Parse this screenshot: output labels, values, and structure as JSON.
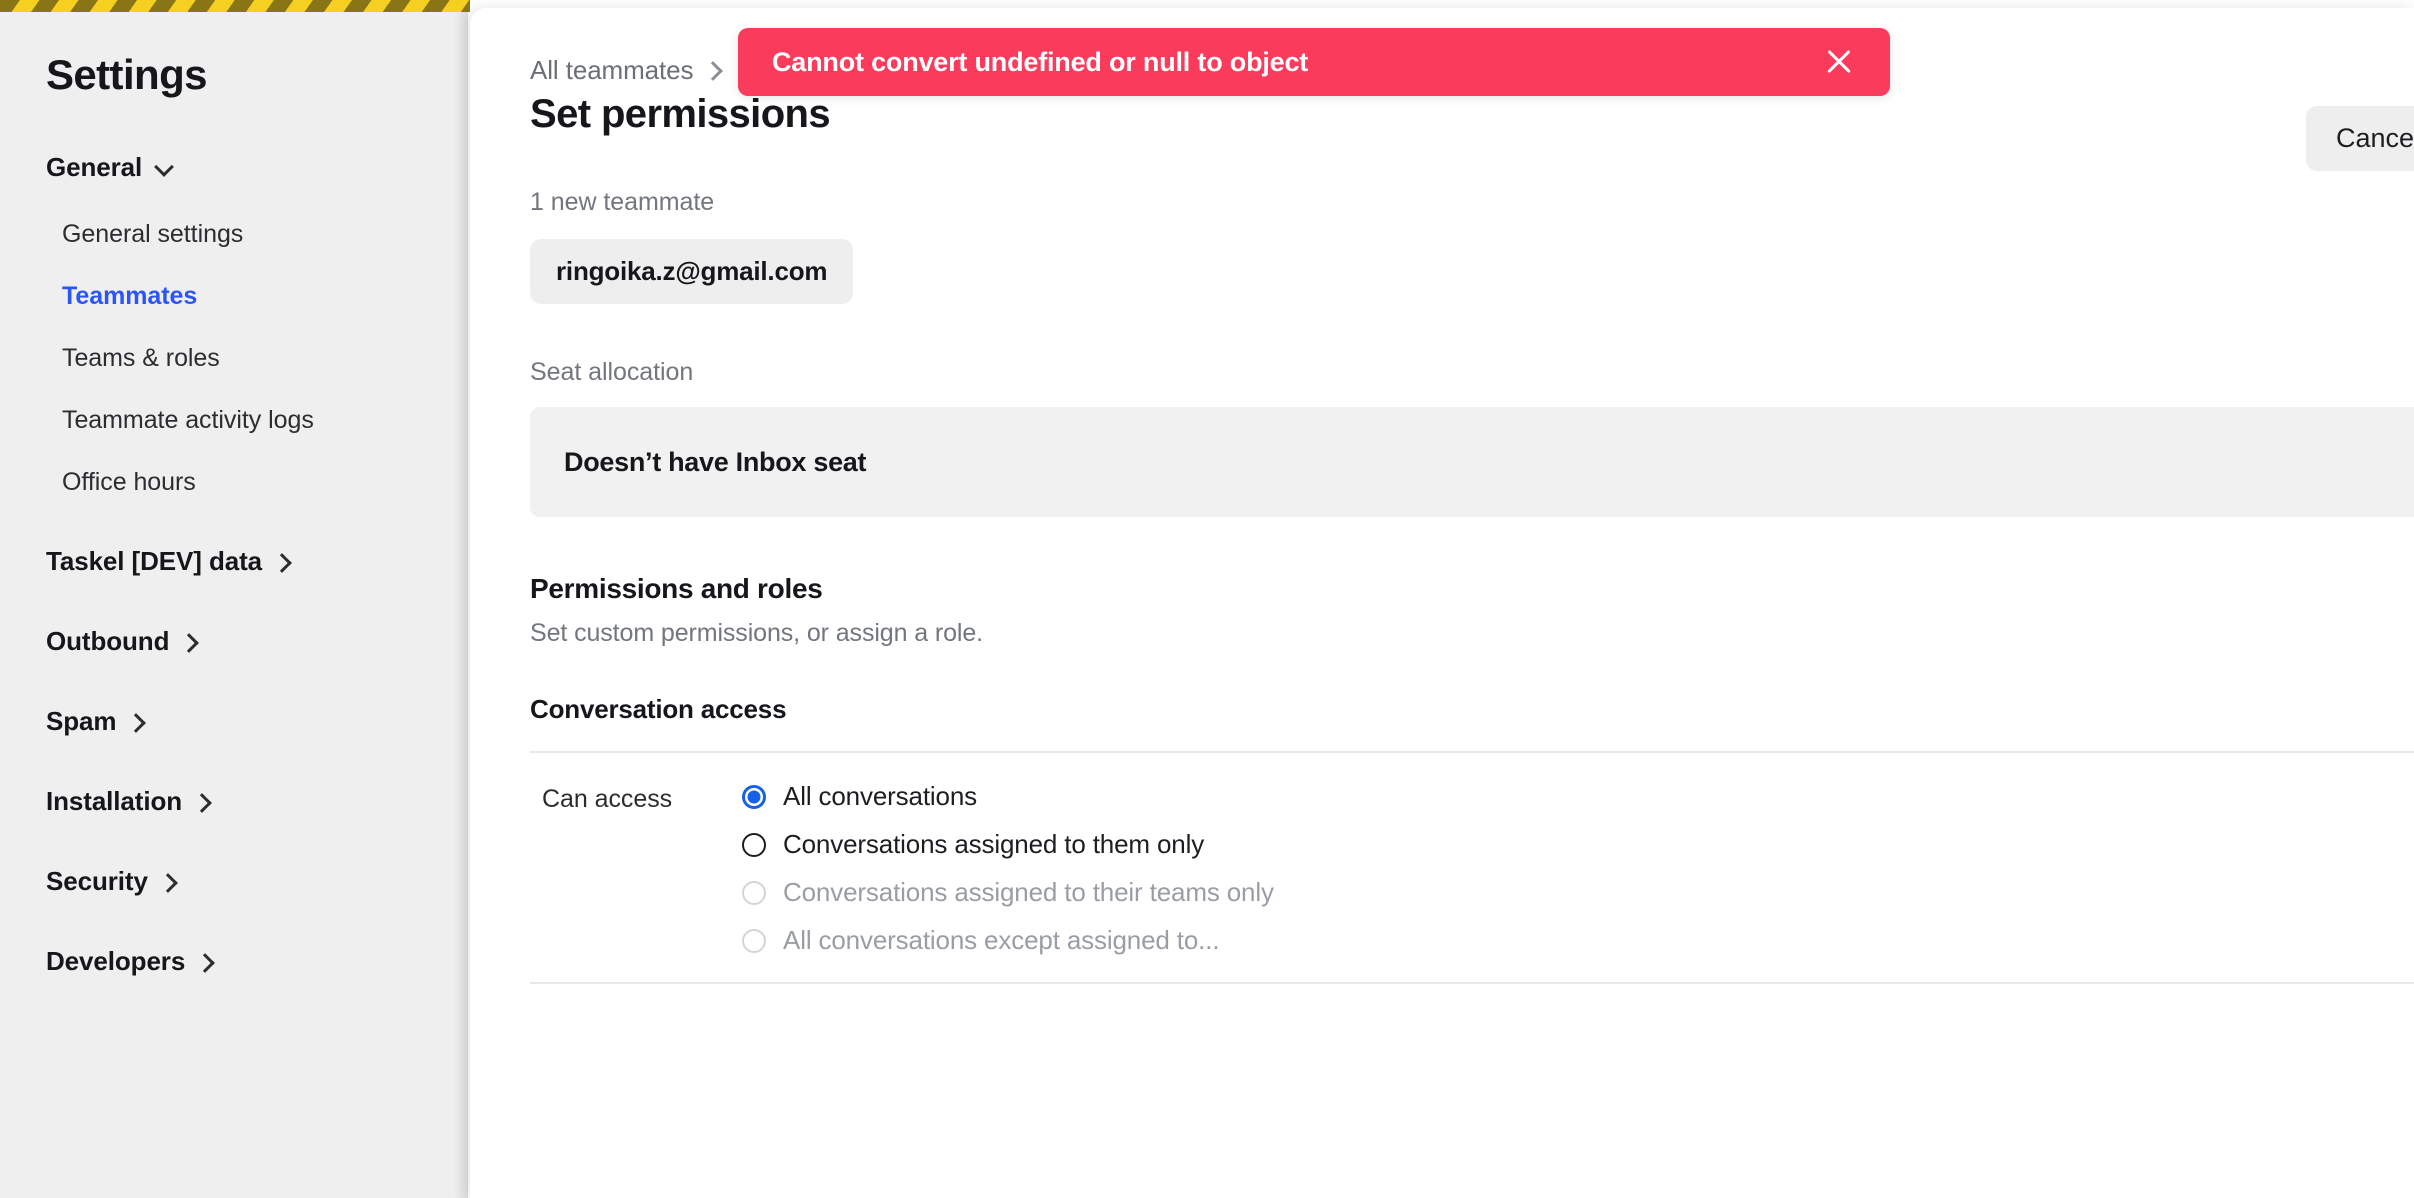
{
  "sidebar": {
    "title": "Settings",
    "groups": [
      {
        "label": "General",
        "expanded": true,
        "icon": "chevron-down-icon",
        "items": [
          {
            "label": "General settings",
            "active": false
          },
          {
            "label": "Teammates",
            "active": true
          },
          {
            "label": "Teams & roles",
            "active": false
          },
          {
            "label": "Teammate activity logs",
            "active": false
          },
          {
            "label": "Office hours",
            "active": false
          }
        ]
      },
      {
        "label": "Taskel [DEV] data",
        "expanded": false,
        "icon": "chevron-right-icon",
        "items": []
      },
      {
        "label": "Outbound",
        "expanded": false,
        "icon": "chevron-right-icon",
        "items": []
      },
      {
        "label": "Spam",
        "expanded": false,
        "icon": "chevron-right-icon",
        "items": []
      },
      {
        "label": "Installation",
        "expanded": false,
        "icon": "chevron-right-icon",
        "items": []
      },
      {
        "label": "Security",
        "expanded": false,
        "icon": "chevron-right-icon",
        "items": []
      },
      {
        "label": "Developers",
        "expanded": false,
        "icon": "chevron-right-icon",
        "items": []
      }
    ]
  },
  "toast": {
    "message": "Cannot convert undefined or null to object",
    "close_icon": "close-icon",
    "background": "#fa3b5b",
    "text_color": "#ffffff"
  },
  "header": {
    "breadcrumb_parent": "All teammates",
    "breadcrumb_separator_icon": "chevron-right-icon",
    "page_title": "Set permissions",
    "cancel_label": "Cancel"
  },
  "teammates": {
    "count_label": "1 new teammate",
    "chips": [
      "ringoika.z@gmail.com"
    ]
  },
  "seat_allocation": {
    "label": "Seat allocation",
    "value": "Doesn’t have Inbox seat"
  },
  "permissions": {
    "section_title": "Permissions and roles",
    "section_subtitle": "Set custom permissions, or assign a role.",
    "subsection_title": "Conversation access",
    "rows": [
      {
        "label": "Can access",
        "options": [
          {
            "label": "All conversations",
            "selected": true,
            "disabled": false
          },
          {
            "label": "Conversations assigned to them only",
            "selected": false,
            "disabled": false
          },
          {
            "label": "Conversations assigned to their teams only",
            "selected": false,
            "disabled": true
          },
          {
            "label": "All conversations except assigned to...",
            "selected": false,
            "disabled": true
          }
        ]
      }
    ]
  },
  "colors": {
    "accent_blue": "#2b55f5",
    "radio_blue": "#1761e8",
    "error_red": "#fa3b5b",
    "sidebar_bg": "#efefef",
    "panel_bg": "#ffffff",
    "caution_yellow": "#f5d020",
    "caution_olive": "#8a7516"
  }
}
